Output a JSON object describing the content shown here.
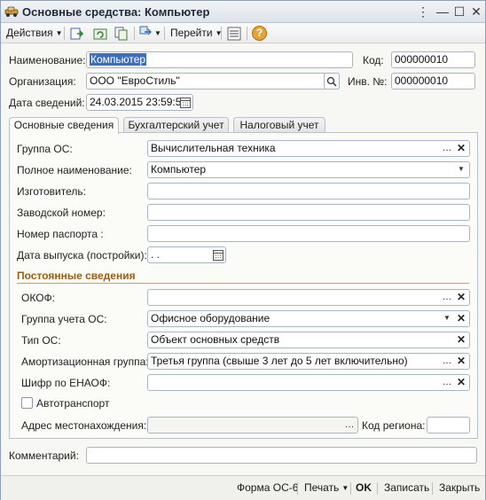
{
  "window": {
    "title": "Основные средства: Компьютер"
  },
  "toolbar": {
    "actions_label": "Действия",
    "goto_label": "Перейти",
    "help_glyph": "?"
  },
  "header": {
    "name_label": "Наименование:",
    "name_value": "Компьютер",
    "code_label": "Код:",
    "code_value": "000000010",
    "org_label": "Организация:",
    "org_value": "ООО \"ЕвроСтиль\"",
    "inv_label": "Инв. №:",
    "inv_value": "000000010",
    "date_label": "Дата сведений:",
    "date_value": "24.03.2015 23:59:59"
  },
  "tabs": [
    {
      "label": "Основные сведения",
      "active": true
    },
    {
      "label": "Бухгалтерский учет",
      "active": false
    },
    {
      "label": "Налоговый учет",
      "active": false
    }
  ],
  "main": {
    "group_label": "Группа ОС:",
    "group_value": "Вычислительная техника",
    "fullname_label": "Полное наименование:",
    "fullname_value": "Компьютер",
    "maker_label": "Изготовитель:",
    "maker_value": "",
    "serial_label": "Заводской номер:",
    "serial_value": "",
    "passport_label": "Номер паспорта :",
    "passport_value": "",
    "release_label": "Дата выпуска (постройки):",
    "release_value": " .  .",
    "section_title": "Постоянные сведения",
    "okof_label": "ОКОФ:",
    "okof_value": "",
    "acc_group_label": "Группа учета ОС:",
    "acc_group_value": "Офисное оборудование",
    "type_label": "Тип ОС:",
    "type_value": "Объект основных средств",
    "amort_label": "Амортизационная группа:",
    "amort_value": "Третья группа (свыше 3 лет до 5 лет включительно)",
    "enaof_label": "Шифр по ЕНАОФ:",
    "enaof_value": "",
    "auto_label": "Автотранспорт",
    "auto_checked": false,
    "address_label": "Адрес местонахождения:",
    "address_value": "",
    "region_label": "Код региона:",
    "region_value": ""
  },
  "comment": {
    "label": "Комментарий:",
    "value": ""
  },
  "statusbar": {
    "form_label": "Форма ОС-6",
    "print_label": "Печать",
    "ok_label": "OK",
    "save_label": "Записать",
    "close_label": "Закрыть"
  },
  "colors": {
    "accent_section": "#9a5d12",
    "selection": "#3d6fb8",
    "help_circle": "#e8a23a"
  }
}
